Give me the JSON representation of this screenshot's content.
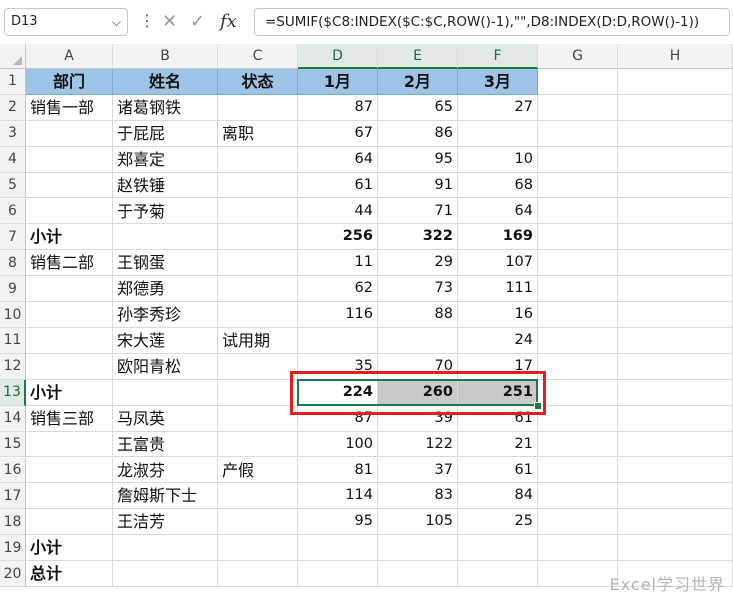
{
  "formula_bar": {
    "name_box": "D13",
    "dropdown_glyph": "⌵",
    "menu_glyph": "⋮",
    "cancel_glyph": "✕",
    "enter_glyph": "✓",
    "fx_glyph": "fx",
    "formula": "=SUMIF($C8:INDEX($C:$C,ROW()-1),\"\",D8:INDEX(D:D,ROW()-1))"
  },
  "columns": [
    "A",
    "B",
    "C",
    "D",
    "E",
    "F",
    "G",
    "H"
  ],
  "selected_column_headers": [
    "D",
    "E",
    "F"
  ],
  "rows": [
    "1",
    "2",
    "3",
    "4",
    "5",
    "6",
    "7",
    "8",
    "9",
    "10",
    "11",
    "12",
    "13",
    "14",
    "15",
    "16",
    "17",
    "18",
    "19",
    "20"
  ],
  "selected_row": "13",
  "header": [
    "部门",
    "姓名",
    "状态",
    "1月",
    "2月",
    "3月"
  ],
  "data": [
    [
      "销售一部",
      "诸葛钢铁",
      "",
      "87",
      "65",
      "27"
    ],
    [
      "",
      "于屁屁",
      "离职",
      "67",
      "86",
      ""
    ],
    [
      "",
      "郑喜定",
      "",
      "64",
      "95",
      "10"
    ],
    [
      "",
      "赵铁锤",
      "",
      "61",
      "91",
      "68"
    ],
    [
      "",
      "于予菊",
      "",
      "44",
      "71",
      "64"
    ],
    [
      "小计",
      "",
      "",
      "256",
      "322",
      "169"
    ],
    [
      "销售二部",
      "王钢蛋",
      "",
      "11",
      "29",
      "107"
    ],
    [
      "",
      "郑德勇",
      "",
      "62",
      "73",
      "111"
    ],
    [
      "",
      "孙李秀珍",
      "",
      "116",
      "88",
      "16"
    ],
    [
      "",
      "宋大莲",
      "试用期",
      "",
      "",
      "24"
    ],
    [
      "",
      "欧阳青松",
      "",
      "35",
      "70",
      "17"
    ],
    [
      "小计",
      "",
      "",
      "224",
      "260",
      "251"
    ],
    [
      "销售三部",
      "马凤英",
      "",
      "87",
      "39",
      "61"
    ],
    [
      "",
      "王富贵",
      "",
      "100",
      "122",
      "21"
    ],
    [
      "",
      "龙淑芬",
      "产假",
      "81",
      "37",
      "61"
    ],
    [
      "",
      "詹姆斯下士",
      "",
      "114",
      "83",
      "84"
    ],
    [
      "",
      "王洁芳",
      "",
      "95",
      "105",
      "25"
    ],
    [
      "小计",
      "",
      "",
      "",
      "",
      ""
    ],
    [
      "总计",
      "",
      "",
      "",
      "",
      ""
    ]
  ],
  "watermark": "Excel学习世界",
  "colors": {
    "header_fill": "#9dc3e6",
    "selection_green": "#1b7a43",
    "highlight_red": "#e02020"
  }
}
